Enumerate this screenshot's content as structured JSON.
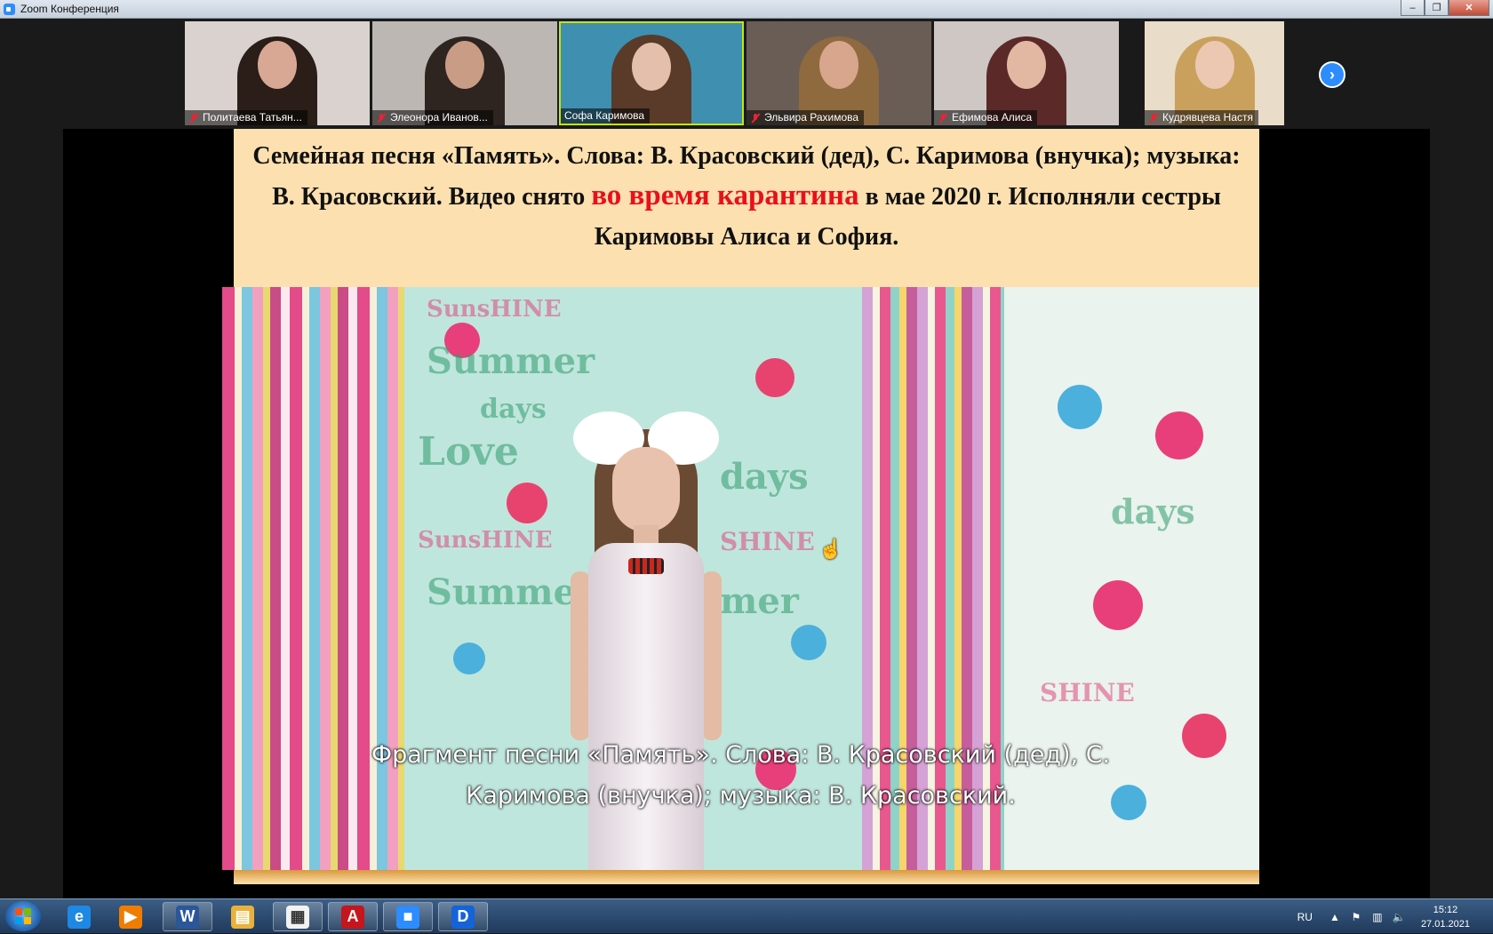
{
  "window": {
    "title": "Zoom Конференция",
    "minimize": "–",
    "maximize": "❐",
    "close": "✕"
  },
  "participants": [
    {
      "name": "Политаева Татьян...",
      "muted": true,
      "bg": "#d9d2cf",
      "hair": "#2b1d18",
      "face": "#d8a894"
    },
    {
      "name": "Элеонора Иванов...",
      "muted": true,
      "bg": "#bcb7b2",
      "hair": "#2e2420",
      "face": "#c99c86"
    },
    {
      "name": "Софа Каримова",
      "muted": false,
      "bg": "#3e8fb0",
      "hair": "#5a3a28",
      "face": "#e4c0ac"
    },
    {
      "name": "Эльвира Рахимова",
      "muted": true,
      "bg": "#6a5d55",
      "hair": "#8e6a3e",
      "face": "#d8a58d"
    },
    {
      "name": "Ефимова Алиса",
      "muted": true,
      "bg": "#cfc7c4",
      "hair": "#5b2a28",
      "face": "#e2b8a2"
    },
    {
      "name": "Кудрявцева Настя",
      "muted": true,
      "bg": "#e9dcc8",
      "hair": "#c9a15c",
      "face": "#ecc8b2"
    }
  ],
  "share": {
    "caption_pre": "Семейная песня «Память».  Слова: В. Красовский (дед), С. Каримова (внучка); музыка:  В. Красовский. Видео снято ",
    "caption_red": "во время карантина",
    "caption_post": " в мае 2020 г. Исполняли сестры Каримовы Алиса  и София.",
    "subtitle_line1": "Фрагмент песни «Память».  Слова: В. Красовский (дед), С.",
    "subtitle_line2": "Каримова (внучка); музыка: В. Красовский.",
    "wall_text": [
      "SunsHINE",
      "Summer",
      "days",
      "Love",
      "SunsHINE",
      "Summer",
      "days",
      "SHINE",
      "mer",
      "days",
      "SHINE"
    ]
  },
  "taskbar": {
    "apps": [
      {
        "id": "ie",
        "glyph": "e",
        "color": "#1e88e5"
      },
      {
        "id": "media",
        "glyph": "▶",
        "color": "#ef7d00"
      },
      {
        "id": "word",
        "glyph": "W",
        "color": "#2b579a"
      },
      {
        "id": "explorer",
        "glyph": "▤",
        "color": "#e8b23a"
      },
      {
        "id": "document",
        "glyph": "▦",
        "color": "#f2f2f2"
      },
      {
        "id": "acrobat",
        "glyph": "A",
        "color": "#c4161c"
      },
      {
        "id": "zoom",
        "glyph": "■",
        "color": "#2d8cff"
      },
      {
        "id": "d-app",
        "glyph": "D",
        "color": "#1463d8"
      }
    ],
    "language": "RU",
    "time": "15:12",
    "date": "27.01.2021"
  }
}
